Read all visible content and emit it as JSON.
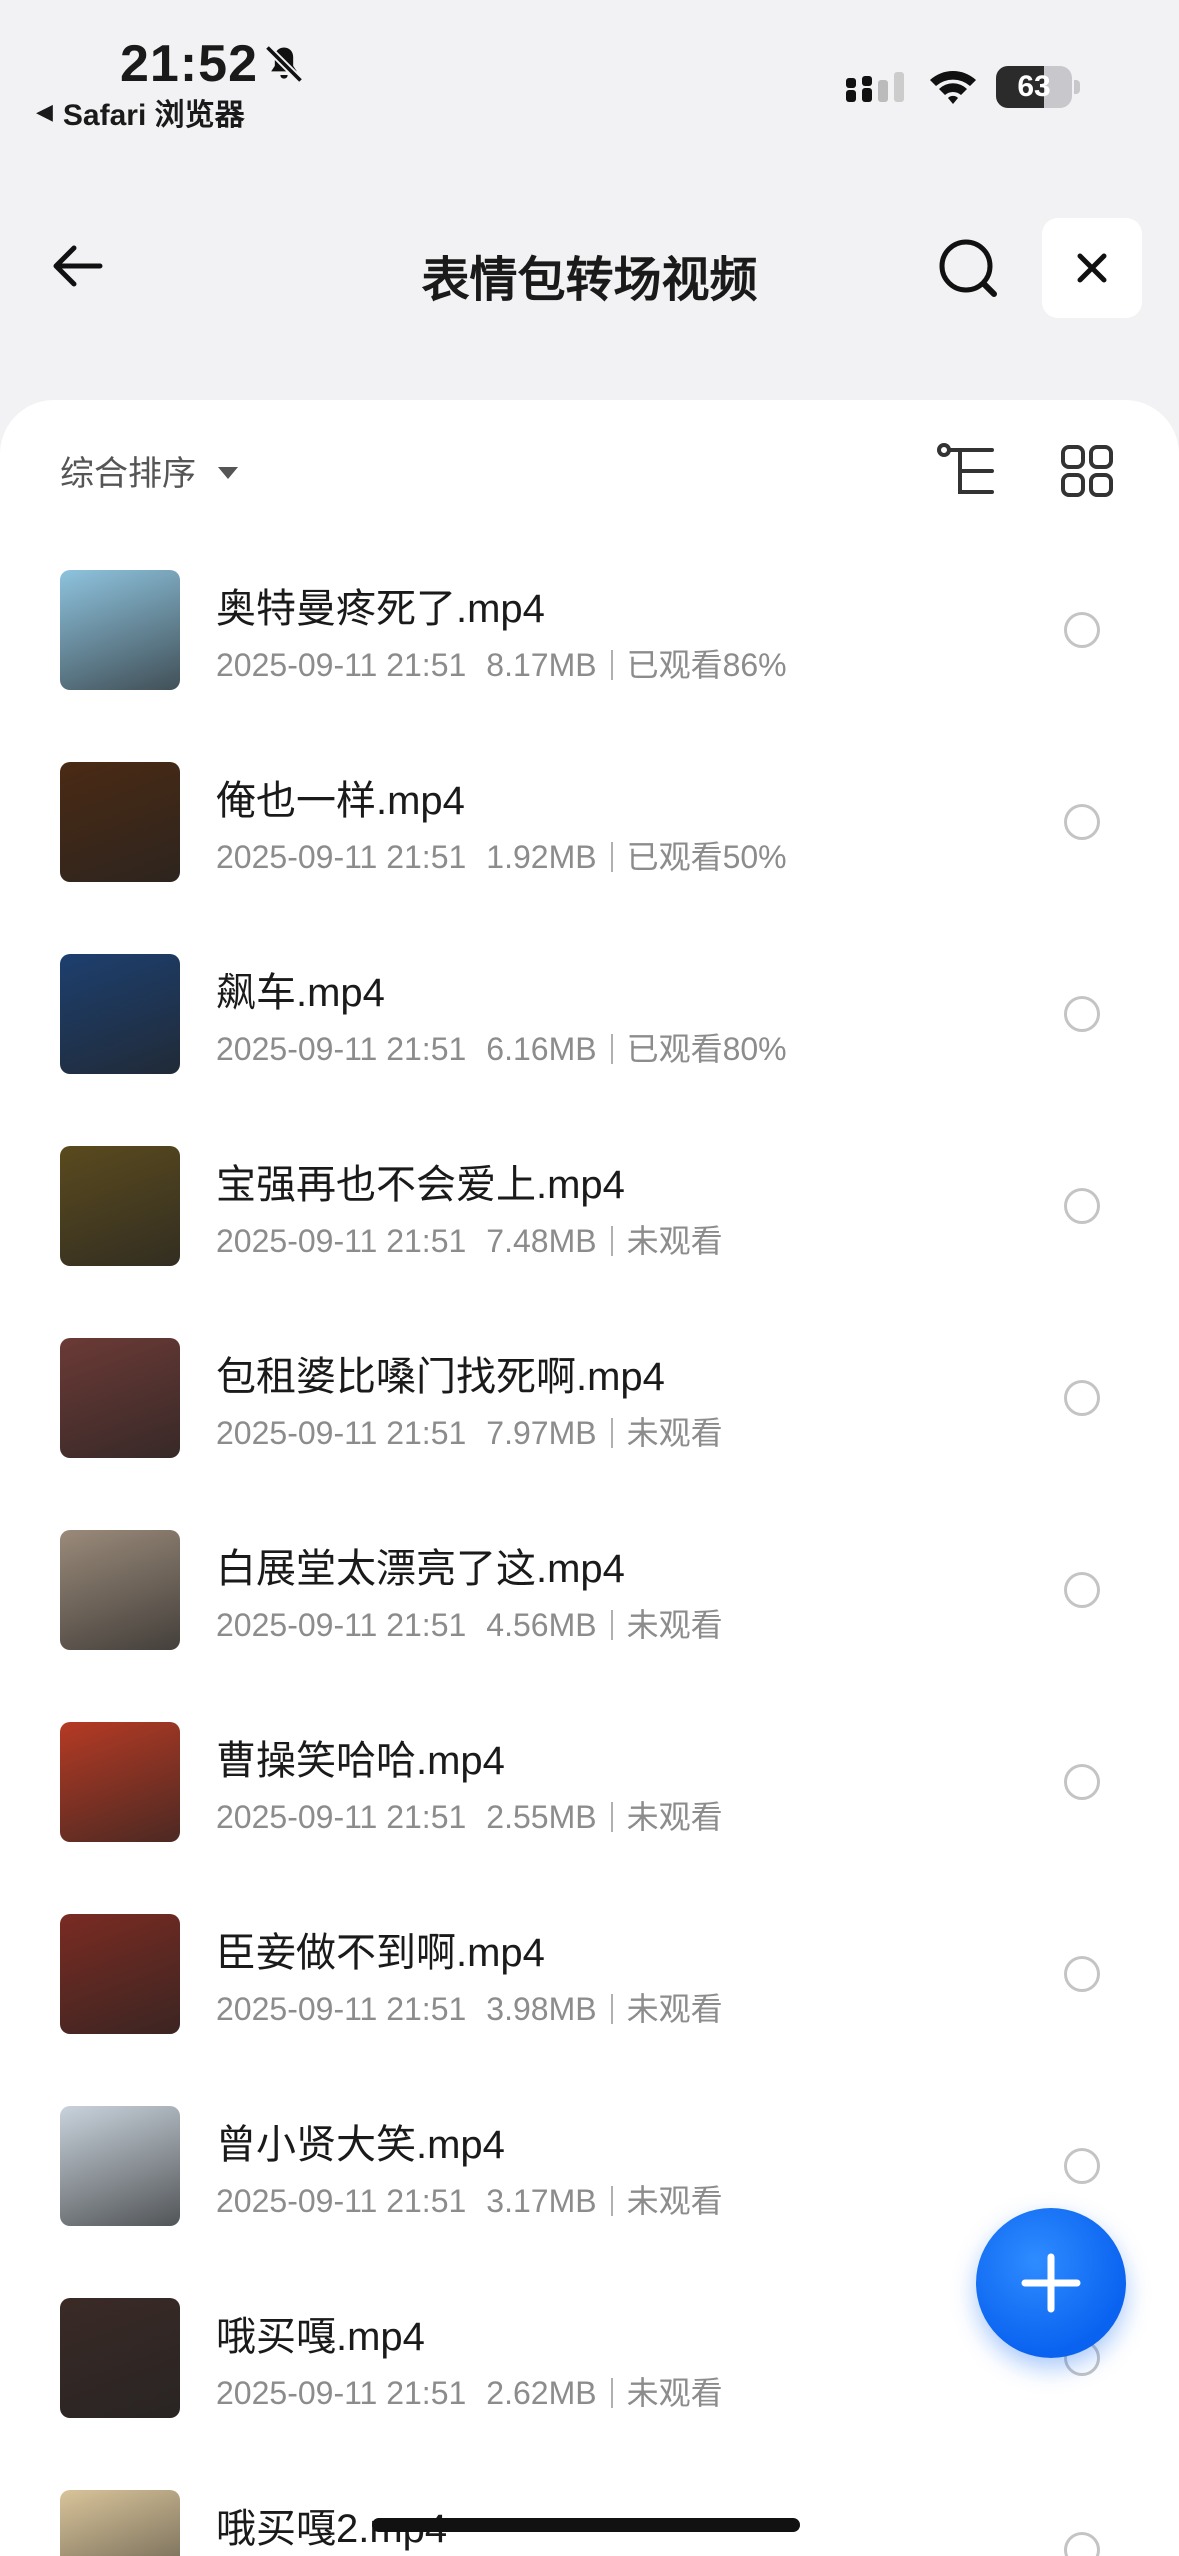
{
  "status": {
    "time": "21:52",
    "back_app": "Safari 浏览器",
    "battery": "63",
    "battery_level": 0.63
  },
  "nav": {
    "title": "表情包转场视频"
  },
  "toolbar": {
    "sort_label": "综合排序"
  },
  "files": [
    {
      "name": "奥特曼疼死了.mp4",
      "date": "2025-09-11 21:51",
      "size": "8.17MB",
      "status": "已观看86%",
      "thumb": "#8ec3de"
    },
    {
      "name": "俺也一样.mp4",
      "date": "2025-09-11 21:51",
      "size": "1.92MB",
      "status": "已观看50%",
      "thumb": "#4a2a14"
    },
    {
      "name": "飙车.mp4",
      "date": "2025-09-11 21:51",
      "size": "6.16MB",
      "status": "已观看80%",
      "thumb": "#1d3f6e"
    },
    {
      "name": "宝强再也不会爱上.mp4",
      "date": "2025-09-11 21:51",
      "size": "7.48MB",
      "status": "未观看",
      "thumb": "#5a4a1e"
    },
    {
      "name": "包租婆比嗓门找死啊.mp4",
      "date": "2025-09-11 21:51",
      "size": "7.97MB",
      "status": "未观看",
      "thumb": "#6b3a36"
    },
    {
      "name": "白展堂太漂亮了这.mp4",
      "date": "2025-09-11 21:51",
      "size": "4.56MB",
      "status": "未观看",
      "thumb": "#9a8a7a"
    },
    {
      "name": "曹操笑哈哈.mp4",
      "date": "2025-09-11 21:51",
      "size": "2.55MB",
      "status": "未观看",
      "thumb": "#b53a24"
    },
    {
      "name": "臣妾做不到啊.mp4",
      "date": "2025-09-11 21:51",
      "size": "3.98MB",
      "status": "未观看",
      "thumb": "#7a2b22"
    },
    {
      "name": "曾小贤大笑.mp4",
      "date": "2025-09-11 21:51",
      "size": "3.17MB",
      "status": "未观看",
      "thumb": "#c9d3dc"
    },
    {
      "name": "哦买嘎.mp4",
      "date": "2025-09-11 21:51",
      "size": "2.62MB",
      "status": "未观看",
      "thumb": "#3a2a26"
    },
    {
      "name": "哦买嘎2.mp4",
      "date": "",
      "size": "",
      "status": "",
      "thumb": "#d9c49a"
    }
  ]
}
